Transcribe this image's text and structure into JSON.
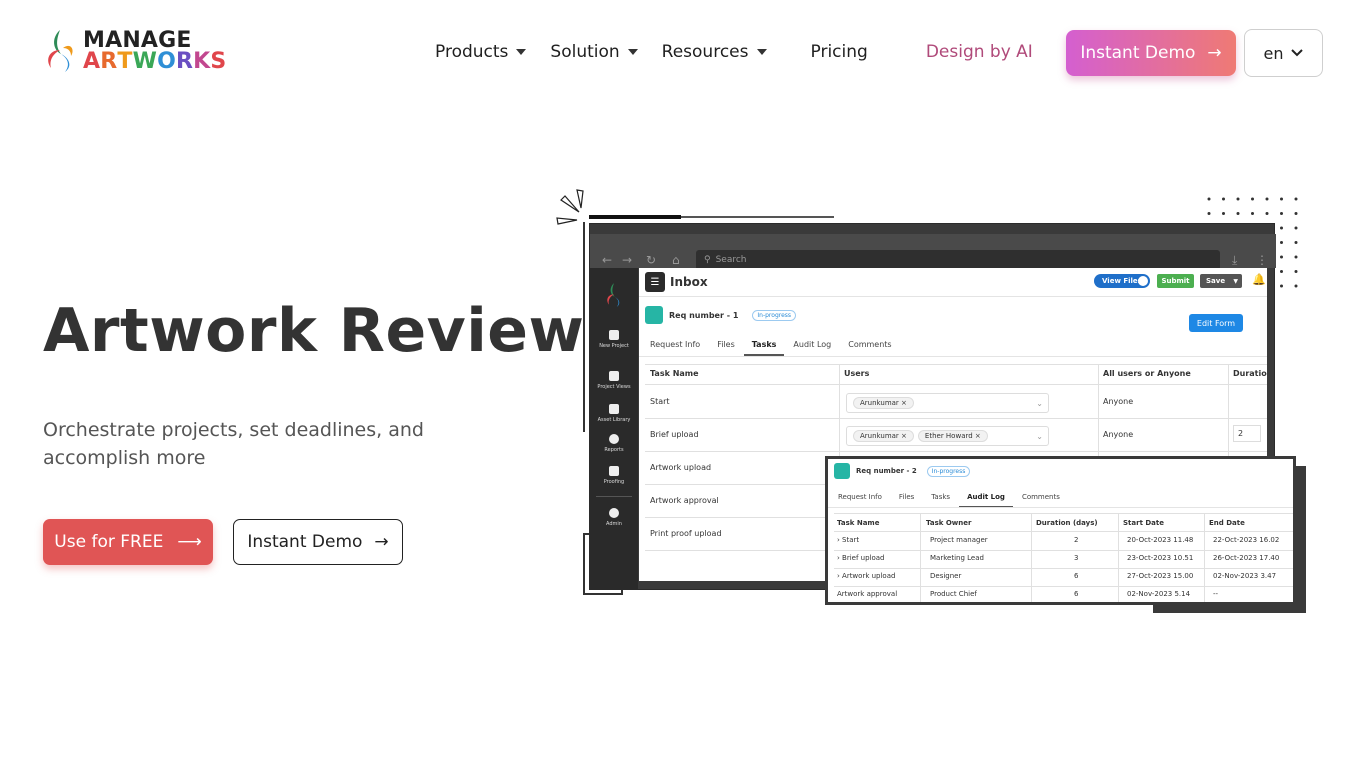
{
  "header": {
    "logo": {
      "line1": "MANAGE",
      "line2": [
        "A",
        "R",
        "T",
        "W",
        "O",
        "R",
        "K",
        "S"
      ],
      "line2_colors": [
        "#e0464b",
        "#e76a2e",
        "#ef9a1b",
        "#3aa757",
        "#2f8fd6",
        "#6a4fc2",
        "#c2478f",
        "#e0464b"
      ]
    },
    "nav": [
      {
        "label": "Products",
        "dropdown": true
      },
      {
        "label": "Solution",
        "dropdown": true
      },
      {
        "label": "Resources",
        "dropdown": true
      },
      {
        "label": "Pricing",
        "dropdown": false
      },
      {
        "label": "Design by AI",
        "dropdown": false
      }
    ],
    "demo_button": "Instant Demo",
    "language": "en"
  },
  "hero": {
    "title": "Artwork Review",
    "subtitle": "Orchestrate projects, set deadlines, and accomplish more",
    "primary_button": "Use for FREE",
    "secondary_button": "Instant Demo"
  },
  "mock": {
    "search_placeholder": "Search",
    "sidebar": [
      "New Project",
      "Project Views",
      "Asset Library",
      "Reports",
      "Proofing",
      "Admin"
    ],
    "inbox_title": "Inbox",
    "toggle_label": "View Files",
    "submit_label": "Submit",
    "save_label": "Save",
    "req1": {
      "label": "Req number - 1",
      "status": "In-progress"
    },
    "edit_form": "Edit Form",
    "tabs1": [
      "Request Info",
      "Files",
      "Tasks",
      "Audit Log",
      "Comments"
    ],
    "tabs1_active": "Tasks",
    "table1": {
      "headers": [
        "Task Name",
        "Users",
        "All users or Anyone",
        "Duration"
      ],
      "rows": [
        {
          "task": "Start",
          "users": [
            "Arunkumar"
          ],
          "anyone": "Anyone",
          "duration": ""
        },
        {
          "task": "Brief upload",
          "users": [
            "Arunkumar",
            "Ether Howard"
          ],
          "anyone": "Anyone",
          "duration": "2"
        },
        {
          "task": "Artwork upload"
        },
        {
          "task": "Artwork approval"
        },
        {
          "task": "Print proof upload"
        }
      ]
    },
    "req2": {
      "label": "Req number - 2",
      "status": "In-progress"
    },
    "tabs2": [
      "Request Info",
      "Files",
      "Tasks",
      "Audit Log",
      "Comments"
    ],
    "tabs2_active": "Audit Log",
    "table2": {
      "headers": [
        "Task Name",
        "Task Owner",
        "Duration (days)",
        "Start Date",
        "End Date"
      ],
      "rows": [
        [
          "› Start",
          "Project manager",
          "2",
          "20-Oct-2023 11.48",
          "22-Oct-2023 16.02"
        ],
        [
          "› Brief upload",
          "Marketing Lead",
          "3",
          "23-Oct-2023 10.51",
          "26-Oct-2023 17.40"
        ],
        [
          "› Artwork upload",
          "Designer",
          "6",
          "27-Oct-2023 15.00",
          "02-Nov-2023 3.47"
        ],
        [
          "Artwork approval",
          "Product Chief",
          "6",
          "02-Nov-2023 5.14",
          "--"
        ]
      ]
    }
  }
}
